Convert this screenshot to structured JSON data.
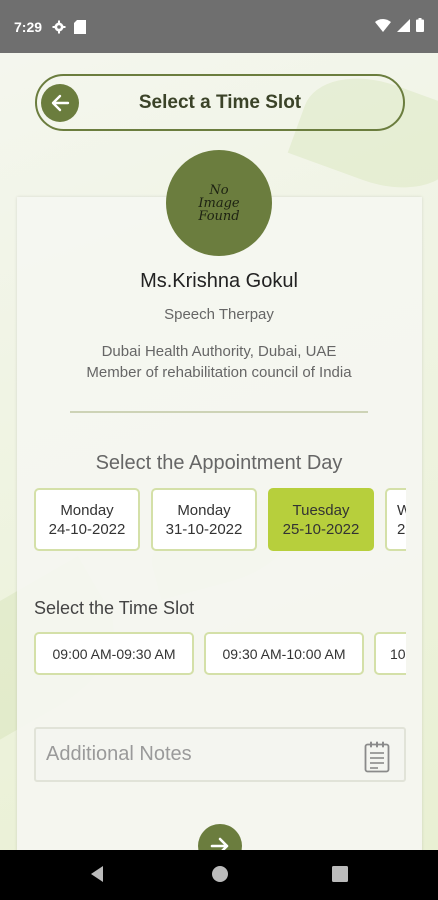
{
  "status_bar": {
    "time": "7:29",
    "icons": [
      "settings-icon",
      "sim-card-icon",
      "wifi-icon",
      "signal-icon",
      "battery-icon"
    ]
  },
  "header": {
    "title": "Select a Time Slot",
    "back_icon": "arrow-left-icon"
  },
  "profile": {
    "avatar_text": "No\nImage\nFound",
    "name": "Ms.Krishna Gokul",
    "specialty": "Speech Therpay",
    "credentials": [
      "Dubai Health Authority, Dubai, UAE",
      "Member of rehabilitation council of India"
    ]
  },
  "day_section": {
    "title": "Select the Appointment Day",
    "days": [
      {
        "day": "Monday",
        "date": "24-10-2022",
        "selected": false
      },
      {
        "day": "Monday",
        "date": "31-10-2022",
        "selected": false
      },
      {
        "day": "Tuesday",
        "date": "25-10-2022",
        "selected": true
      },
      {
        "day": "W",
        "date": "2",
        "selected": false
      }
    ]
  },
  "time_section": {
    "title": "Select the Time Slot",
    "slots": [
      "09:00 AM-09:30 AM",
      "09:30 AM-10:00 AM",
      "10"
    ]
  },
  "notes": {
    "placeholder": "Additional Notes",
    "value": "",
    "icon": "notepad-icon"
  },
  "footer": {
    "next_icon": "arrow-right-icon"
  },
  "nav_bar": {
    "icons": [
      "back-triangle-icon",
      "home-circle-icon",
      "recents-square-icon"
    ]
  },
  "colors": {
    "accent": "#6b7d3e",
    "selected_chip": "#b7cf3c",
    "chip_border": "#d4e0a8"
  }
}
